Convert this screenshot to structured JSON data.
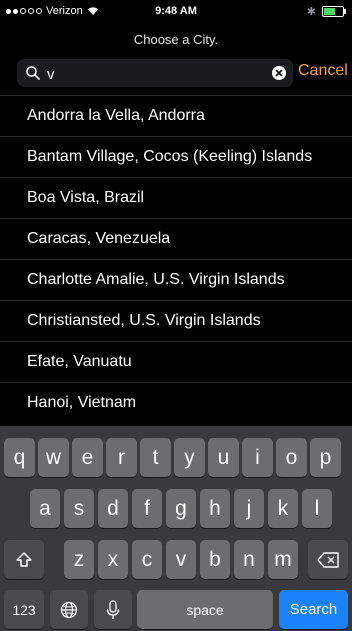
{
  "status": {
    "carrier": "Verizon",
    "time": "9:48 AM"
  },
  "prompt": "Choose a City.",
  "search": {
    "value": "v",
    "cancel_label": "Cancel"
  },
  "cities": [
    "Andorra la Vella, Andorra",
    "Bantam Village, Cocos (Keeling) Islands",
    "Boa Vista, Brazil",
    "Caracas, Venezuela",
    "Charlotte Amalie, U.S. Virgin Islands",
    "Christiansted, U.S. Virgin Islands",
    "Efate, Vanuatu",
    "Hanoi, Vietnam"
  ],
  "keyboard": {
    "row1": [
      "q",
      "w",
      "e",
      "r",
      "t",
      "y",
      "u",
      "i",
      "o",
      "p"
    ],
    "row2": [
      "a",
      "s",
      "d",
      "f",
      "g",
      "h",
      "j",
      "k",
      "l"
    ],
    "row3": [
      "z",
      "x",
      "c",
      "v",
      "b",
      "n",
      "m"
    ],
    "numbers_label": "123",
    "space_label": "space",
    "search_label": "Search"
  },
  "colors": {
    "accent": "#f5a623",
    "search_key": "#1a82fb",
    "battery": "#4cd964"
  }
}
